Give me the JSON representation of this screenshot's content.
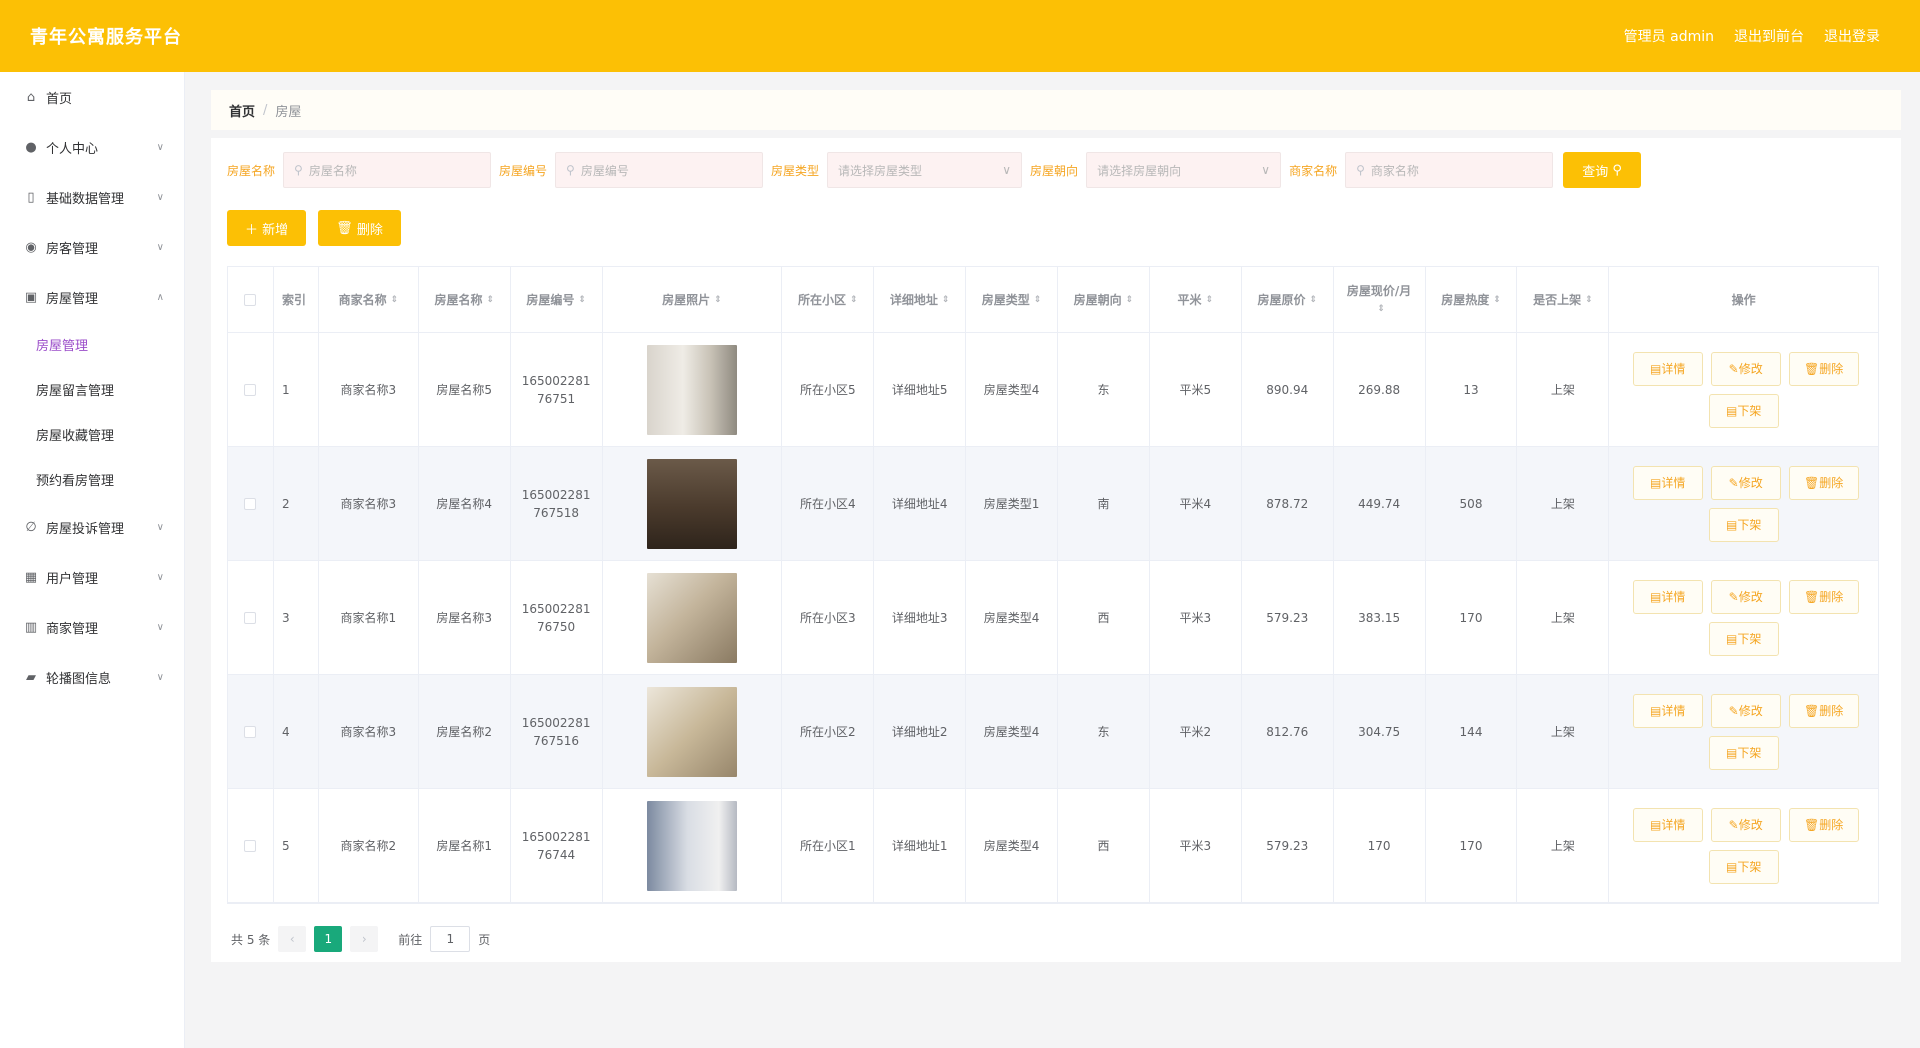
{
  "header": {
    "title": "青年公寓服务平台",
    "admin_label": "管理员 admin",
    "exit_to_front": "退出到前台",
    "logout": "退出登录"
  },
  "sidebar": {
    "items": [
      {
        "label": "首页",
        "icon": "home-icon"
      },
      {
        "label": "个人中心",
        "icon": "user-icon"
      },
      {
        "label": "基础数据管理",
        "icon": "database-icon"
      },
      {
        "label": "房客管理",
        "icon": "tenant-icon"
      },
      {
        "label": "房屋管理",
        "icon": "house-icon"
      },
      {
        "label": "房屋投诉管理",
        "icon": "complaint-icon"
      },
      {
        "label": "用户管理",
        "icon": "users-icon"
      },
      {
        "label": "商家管理",
        "icon": "shop-icon"
      },
      {
        "label": "轮播图信息",
        "icon": "carousel-icon"
      }
    ],
    "house_submenu": [
      "房屋管理",
      "房屋留言管理",
      "房屋收藏管理",
      "预约看房管理"
    ]
  },
  "breadcrumb": {
    "home": "首页",
    "sep": "/",
    "current": "房屋"
  },
  "search": {
    "name_label": "房屋名称",
    "name_placeholder": "房屋名称",
    "code_label": "房屋编号",
    "code_placeholder": "房屋编号",
    "type_label": "房屋类型",
    "type_placeholder": "请选择房屋类型",
    "orient_label": "房屋朝向",
    "orient_placeholder": "请选择房屋朝向",
    "shop_label": "商家名称",
    "shop_placeholder": "商家名称",
    "query_btn": "查询"
  },
  "actions": {
    "add": "新增",
    "delete": "删除"
  },
  "table": {
    "headers": [
      "索引",
      "商家名称",
      "房屋名称",
      "房屋编号",
      "房屋照片",
      "所在小区",
      "详细地址",
      "房屋类型",
      "房屋朝向",
      "平米",
      "房屋原价",
      "房屋现价/月",
      "房屋热度",
      "是否上架",
      "操作"
    ],
    "rows": [
      {
        "idx": "1",
        "shop": "商家名称3",
        "name": "房屋名称5",
        "code": "165002281 76751",
        "community": "所在小区5",
        "address": "详细地址5",
        "type": "房屋类型4",
        "orient": "东",
        "area": "平米5",
        "orig": "890.94",
        "now": "269.88",
        "heat": "13",
        "on": "上架"
      },
      {
        "idx": "2",
        "shop": "商家名称3",
        "name": "房屋名称4",
        "code": "165002281 767518",
        "community": "所在小区4",
        "address": "详细地址4",
        "type": "房屋类型1",
        "orient": "南",
        "area": "平米4",
        "orig": "878.72",
        "now": "449.74",
        "heat": "508",
        "on": "上架"
      },
      {
        "idx": "3",
        "shop": "商家名称1",
        "name": "房屋名称3",
        "code": "165002281 76750",
        "community": "所在小区3",
        "address": "详细地址3",
        "type": "房屋类型4",
        "orient": "西",
        "area": "平米3",
        "orig": "579.23",
        "now": "383.15",
        "heat": "170",
        "on": "上架"
      },
      {
        "idx": "4",
        "shop": "商家名称3",
        "name": "房屋名称2",
        "code": "165002281 767516",
        "community": "所在小区2",
        "address": "详细地址2",
        "type": "房屋类型4",
        "orient": "东",
        "area": "平米2",
        "orig": "812.76",
        "now": "304.75",
        "heat": "144",
        "on": "上架"
      },
      {
        "idx": "5",
        "shop": "商家名称2",
        "name": "房屋名称1",
        "code": "165002281 76744",
        "community": "所在小区1",
        "address": "详细地址1",
        "type": "房屋类型4",
        "orient": "西",
        "area": "平米3",
        "orig": "579.23",
        "now": "170",
        "heat": "170",
        "on": "上架"
      }
    ],
    "op_detail": "详情",
    "op_edit": "修改",
    "op_delete": "删除",
    "op_down": "下架"
  },
  "pagination": {
    "total": "共 5 条",
    "current": "1",
    "goto": "前往",
    "page_input": "1",
    "page_unit": "页"
  },
  "colors": {
    "brand": "#fcc005",
    "accent_text": "#f5a623",
    "active_menu": "#9b4dca",
    "page_current": "#19a97b"
  }
}
